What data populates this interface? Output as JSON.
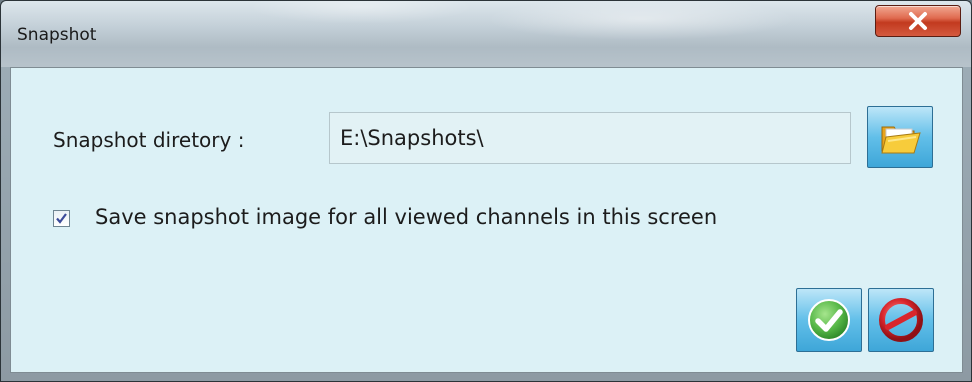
{
  "window": {
    "title": "Snapshot",
    "close_glyph": "x"
  },
  "form": {
    "directory_label": "Snapshot diretory :",
    "directory_value": "E:\\Snapshots\\",
    "checkbox_label": "Save snapshot image for all viewed channels in this screen",
    "checkbox_checked": true
  },
  "icons": {
    "browse": "folder-open-icon",
    "ok": "green-check-icon",
    "cancel": "red-prohibited-icon"
  },
  "colors": {
    "client_bg": "#dcf1f6",
    "button_blue": "#62bfe9",
    "close_red": "#c23a1f",
    "ok_green": "#58b848",
    "cancel_red": "#d9262c"
  }
}
